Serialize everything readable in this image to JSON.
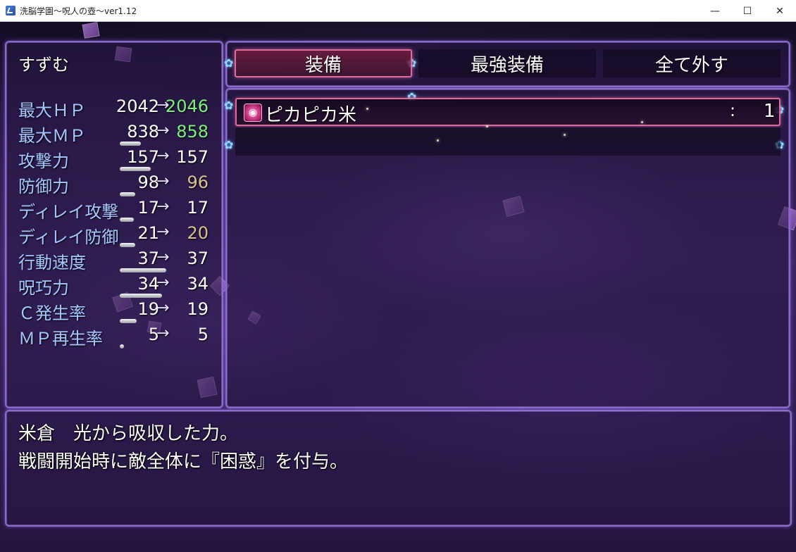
{
  "window": {
    "title": "洗脳学園～呪人の壺～ver1.12",
    "minimize": "—",
    "maximize": "☐",
    "close": "✕"
  },
  "character": {
    "name": "すずむ"
  },
  "stats": [
    {
      "label": "最大ＨＰ",
      "before": "2042",
      "arrow": "→",
      "after": "2046",
      "color": "#7cf07c"
    },
    {
      "label": "最大ＭＰ",
      "before": "838",
      "arrow": "→",
      "after": "858",
      "color": "#7cf07c"
    },
    {
      "label": "攻撃力",
      "before": "157",
      "arrow": "→",
      "after": "157",
      "color": "#ffffff"
    },
    {
      "label": "防御力",
      "before": "98",
      "arrow": "→",
      "after": "96",
      "color": "#d8c090"
    },
    {
      "label": "ディレイ攻撃",
      "before": "17",
      "arrow": "→",
      "after": "17",
      "color": "#ffffff"
    },
    {
      "label": "ディレイ防御",
      "before": "21",
      "arrow": "→",
      "after": "20",
      "color": "#d8c090"
    },
    {
      "label": "行動速度",
      "before": "37",
      "arrow": "→",
      "after": "37",
      "color": "#ffffff"
    },
    {
      "label": "呪巧力",
      "before": "34",
      "arrow": "→",
      "after": "34",
      "color": "#ffffff"
    },
    {
      "label": "Ｃ発生率",
      "before": "19",
      "arrow": "→",
      "after": "19",
      "color": "#ffffff"
    },
    {
      "label": "ＭＰ再生率",
      "before": "5",
      "arrow": "→",
      "after": "5",
      "color": "#ffffff"
    }
  ],
  "commands": {
    "equip": "装備",
    "optimize": "最強装備",
    "remove_all": "全て外す"
  },
  "items": [
    {
      "icon": "rice-icon",
      "name": "ピカピカ米",
      "separator": ":",
      "quantity": "1"
    }
  ],
  "help": {
    "line1": "米倉　光から吸収した力。",
    "line2": "戦闘開始時に敵全体に『困惑』を付与。"
  }
}
